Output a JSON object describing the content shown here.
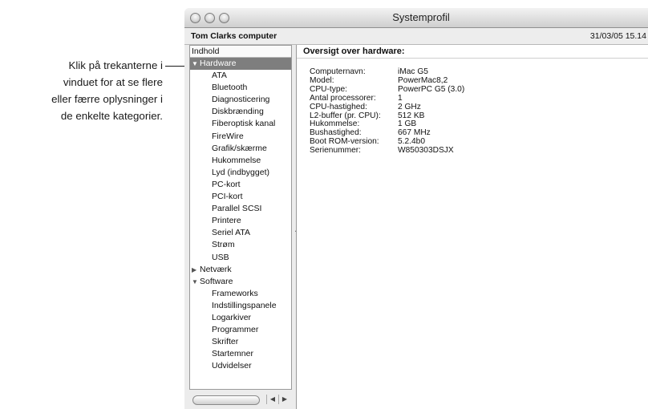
{
  "callout": {
    "lines": [
      "Klik på trekanterne i",
      "vinduet for at se flere",
      "eller færre oplysninger i",
      "de enkelte kategorier."
    ]
  },
  "window": {
    "title": "Systemprofil",
    "computer_name": "Tom Clarks computer",
    "datetime": "31/03/05 15.14"
  },
  "sidebar": {
    "header": "Indhold",
    "items": [
      {
        "label": "Hardware",
        "type": "parent",
        "expanded": true,
        "selected": true
      },
      {
        "label": "ATA",
        "type": "child"
      },
      {
        "label": "Bluetooth",
        "type": "child"
      },
      {
        "label": "Diagnosticering",
        "type": "child"
      },
      {
        "label": "Diskbrænding",
        "type": "child"
      },
      {
        "label": "Fiberoptisk kanal",
        "type": "child"
      },
      {
        "label": "FireWire",
        "type": "child"
      },
      {
        "label": "Grafik/skærme",
        "type": "child"
      },
      {
        "label": "Hukommelse",
        "type": "child"
      },
      {
        "label": "Lyd (indbygget)",
        "type": "child"
      },
      {
        "label": "PC-kort",
        "type": "child"
      },
      {
        "label": "PCI-kort",
        "type": "child"
      },
      {
        "label": "Parallel SCSI",
        "type": "child"
      },
      {
        "label": "Printere",
        "type": "child"
      },
      {
        "label": "Seriel ATA",
        "type": "child"
      },
      {
        "label": "Strøm",
        "type": "child"
      },
      {
        "label": "USB",
        "type": "child"
      },
      {
        "label": "Netværk",
        "type": "parent",
        "expanded": false
      },
      {
        "label": "Software",
        "type": "parent",
        "expanded": true
      },
      {
        "label": "Frameworks",
        "type": "child"
      },
      {
        "label": "Indstillingspanele",
        "type": "child"
      },
      {
        "label": "Logarkiver",
        "type": "child"
      },
      {
        "label": "Programmer",
        "type": "child"
      },
      {
        "label": "Skrifter",
        "type": "child"
      },
      {
        "label": "Startemner",
        "type": "child"
      },
      {
        "label": "Udvidelser",
        "type": "child"
      }
    ]
  },
  "content": {
    "section_title": "Oversigt over hardware:",
    "specs": [
      {
        "label": "Computernavn:",
        "value": "iMac G5"
      },
      {
        "label": "Model:",
        "value": "PowerMac8,2"
      },
      {
        "label": "CPU-type:",
        "value": "PowerPC G5  (3.0)"
      },
      {
        "label": "Antal processorer:",
        "value": "1"
      },
      {
        "label": "CPU-hastighed:",
        "value": "2 GHz"
      },
      {
        "label": "L2-buffer (pr. CPU):",
        "value": "512 KB"
      },
      {
        "label": "Hukommelse:",
        "value": "1 GB"
      },
      {
        "label": "Bushastighed:",
        "value": "667 MHz"
      },
      {
        "label": "Boot ROM-version:",
        "value": "5.2.4b0"
      },
      {
        "label": "Serienummer:",
        "value": "W850303DSJX"
      }
    ]
  }
}
